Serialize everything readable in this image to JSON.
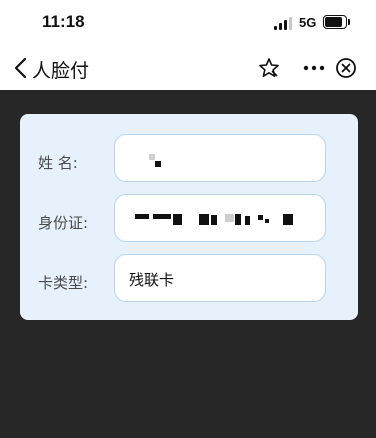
{
  "status_bar": {
    "time": "11:18",
    "network": "5G"
  },
  "nav": {
    "title": "人脸付",
    "icons": [
      "chevron-left-icon",
      "star-icon",
      "more-icon",
      "close-circle-icon"
    ]
  },
  "form": {
    "name_label": "姓  名:",
    "id_label": "身份证:",
    "card_type_label": "卡类型:",
    "card_type_value": "残联卡"
  },
  "colors": {
    "content_background": "#272727",
    "card_background": "#e6f1fb",
    "field_border": "#b9d6ef"
  }
}
